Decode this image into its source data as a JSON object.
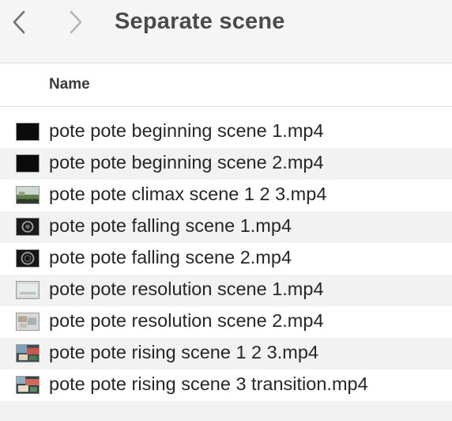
{
  "window": {
    "title": "Separate scene"
  },
  "toolbar": {
    "back_icon": "chevron-left",
    "forward_icon": "chevron-right"
  },
  "list": {
    "columns": {
      "name": "Name"
    },
    "files": [
      {
        "name": "pote pote beginning scene 1.mp4",
        "thumbnail": "black-frame"
      },
      {
        "name": "pote pote beginning scene 2.mp4",
        "thumbnail": "black-frame"
      },
      {
        "name": "pote pote climax scene 1 2 3.mp4",
        "thumbnail": "landscape-frame"
      },
      {
        "name": "pote pote falling scene 1.mp4",
        "thumbnail": "dark-circle-frame"
      },
      {
        "name": "pote pote falling scene 2.mp4",
        "thumbnail": "dark-circle-frame"
      },
      {
        "name": "pote pote resolution scene 1.mp4",
        "thumbnail": "light-frame"
      },
      {
        "name": "pote pote resolution scene 2.mp4",
        "thumbnail": "light-mixed-frame"
      },
      {
        "name": "pote pote rising scene 1 2 3.mp4",
        "thumbnail": "colorful-frame"
      },
      {
        "name": "pote pote rising scene 3 transition.mp4",
        "thumbnail": "colorful-frame"
      }
    ]
  },
  "colors": {
    "toolbar_bg": "#f5f5f5",
    "row_alt_bg": "#f2f2f2",
    "title_text": "#4b4b4b",
    "nav_icon": "#8e8e8e"
  }
}
